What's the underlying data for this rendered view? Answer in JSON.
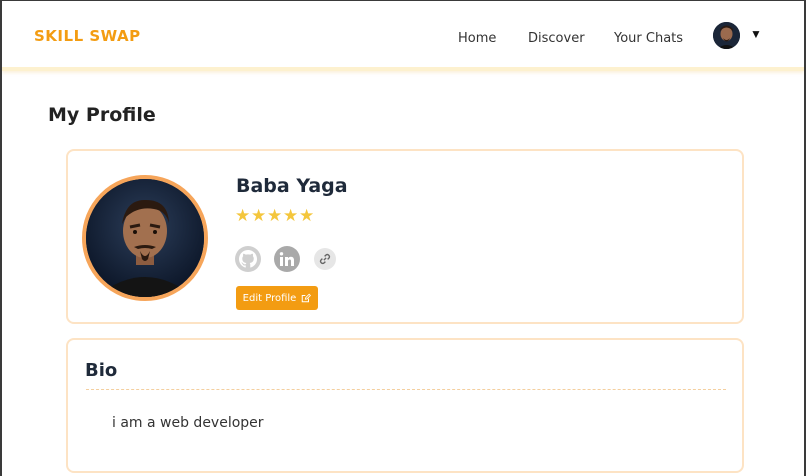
{
  "navbar": {
    "brand": "SKILL SWAP",
    "links": [
      "Home",
      "Discover",
      "Your Chats"
    ],
    "caret": "▼",
    "avatar_icon": "user-avatar"
  },
  "page": {
    "title": "My Profile"
  },
  "profile": {
    "name": "Baba Yaga",
    "rating": 5,
    "rating_max": 5,
    "stars": "★★★★★",
    "social_icons": [
      "github-icon",
      "linkedin-icon",
      "link-icon"
    ],
    "edit_label": "Edit Profile"
  },
  "bio": {
    "title": "Bio",
    "text": "i am a web developer"
  },
  "colors": {
    "accent": "#f39c12",
    "card_border": "#fde3c4",
    "avatar_ring": "#f6a55a",
    "star": "#f4c63c"
  }
}
